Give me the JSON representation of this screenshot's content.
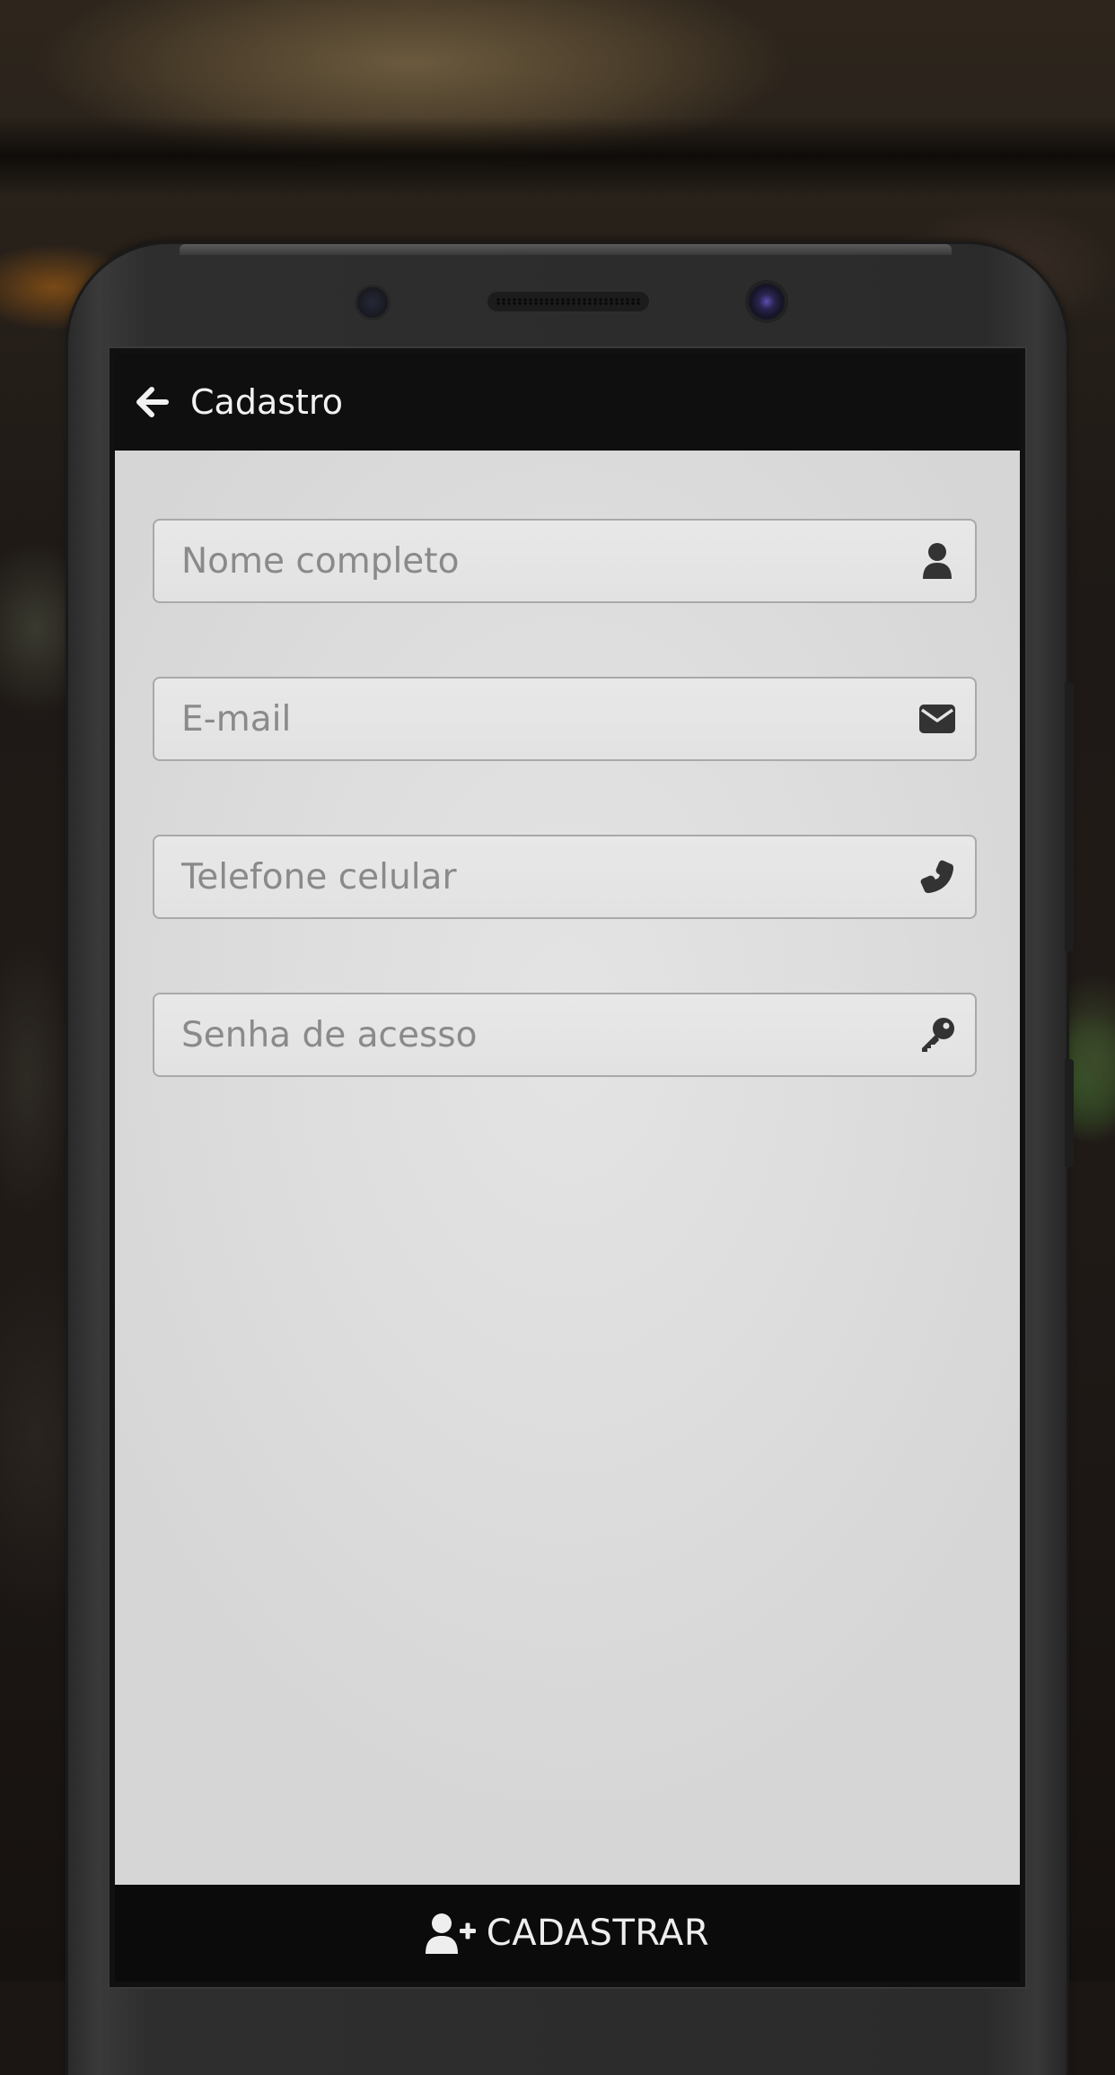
{
  "app_bar": {
    "title": "Cadastro",
    "back_icon": "arrow-left-icon"
  },
  "form": {
    "fields": [
      {
        "placeholder": "Nome completo",
        "value": "",
        "icon": "user-icon"
      },
      {
        "placeholder": "E-mail",
        "value": "",
        "icon": "envelope-icon"
      },
      {
        "placeholder": "Telefone celular",
        "value": "",
        "icon": "phone-icon"
      },
      {
        "placeholder": "Senha de acesso",
        "value": "",
        "icon": "key-icon"
      }
    ]
  },
  "submit": {
    "label": "CADASTRAR",
    "icon": "user-plus-icon"
  },
  "colors": {
    "app_bar_bg": "#0f0f0f",
    "content_bg": "#dfdfdf",
    "field_border": "#a9a9a9",
    "icon_color": "#333333",
    "submit_bar_bg": "#0b0b0b"
  }
}
